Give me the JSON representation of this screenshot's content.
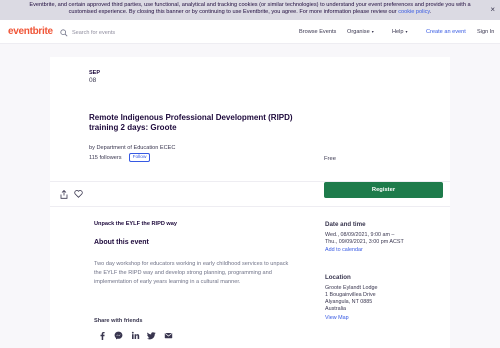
{
  "cookie_banner": {
    "line1": "Eventbrite, and certain approved third parties, use functional, analytical and tracking cookies (or similar technologies) to understand your event preferences and provide you with a",
    "line2_prefix": "customised experience. By closing this banner or by continuing to use Eventbrite, you agree. For more information please review our",
    "policy_link": "cookie policy",
    "line2_suffix": ".",
    "close": "×"
  },
  "header": {
    "logo": "eventbrite",
    "search_placeholder": "Search for events",
    "nav": {
      "browse": "Browse Events",
      "organise": "Organise",
      "help": "Help",
      "create": "Create an event",
      "signin": "Sign In"
    }
  },
  "event": {
    "month": "SEP",
    "day": "08",
    "title": "Remote Indigenous Professional Development (RIPD) training 2 days: Groote",
    "organizer": "by Department of Education ECEC",
    "followers": "115 followers",
    "follow_label": "Follow",
    "price": "Free",
    "register_label": "Register",
    "summary": "Unpack the EYLF the RIPD way",
    "about_title": "About this event",
    "about_body": "Two day workshop for educators working in early childhood services to unpack the EYLF the RIPD way and develop strong planning, programming and implementation of early years learning in a cultural manner.",
    "share_title": "Share with friends",
    "social_icons": [
      "facebook-icon",
      "messenger-icon",
      "linkedin-icon",
      "twitter-icon",
      "email-icon"
    ]
  },
  "date_time": {
    "title": "Date and time",
    "line1": "Wed., 08/09/2021, 9:00 am –",
    "line2": "Thu., 09/09/2021, 3:00 pm ACST",
    "calendar_link": "Add to calendar"
  },
  "location": {
    "title": "Location",
    "lines": [
      "Groote Eylandt Lodge",
      "1 Bougainvillea Drive",
      "Alyangula, NT 0885",
      "Australia"
    ],
    "map_link": "View Map"
  },
  "colors": {
    "brand": "#f05537",
    "register": "#1e7b4b",
    "link": "#3659e3"
  }
}
